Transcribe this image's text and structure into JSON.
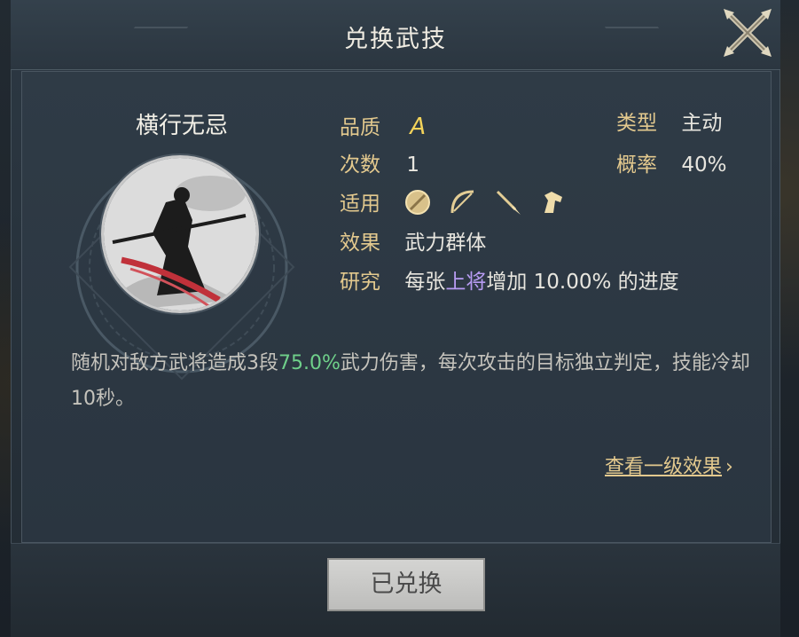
{
  "dialog": {
    "title": "兑换武技",
    "close_icon": "close-crossed-swords-icon"
  },
  "skill": {
    "name": "横行无忌",
    "quality_label": "品质",
    "quality_value": "A",
    "type_label": "类型",
    "type_value": "主动",
    "count_label": "次数",
    "count_value": "1",
    "chance_label": "概率",
    "chance_value": "40%",
    "applies_label": "适用",
    "applies_icons": [
      "shield-icon",
      "bow-icon",
      "spear-icon",
      "horse-icon"
    ],
    "effect_label": "效果",
    "effect_value": "武力群体",
    "research_label": "研究",
    "research_prefix": "每张",
    "research_highlight": "上将",
    "research_suffix": "增加 10.00% 的进度",
    "desc_prefix": "随机对敌方武将造成3段",
    "desc_highlight": "75.0%",
    "desc_suffix": "武力伤害，每次攻击的目标独立判定，技能冷却10秒。"
  },
  "links": {
    "view_level_one": "查看一级效果"
  },
  "buttons": {
    "redeemed": "已兑换"
  },
  "colors": {
    "label_gold": "#e3c98e",
    "quality_yellow": "#f3d35a",
    "highlight_purple": "#b79bf2",
    "highlight_green": "#6fd08a"
  }
}
